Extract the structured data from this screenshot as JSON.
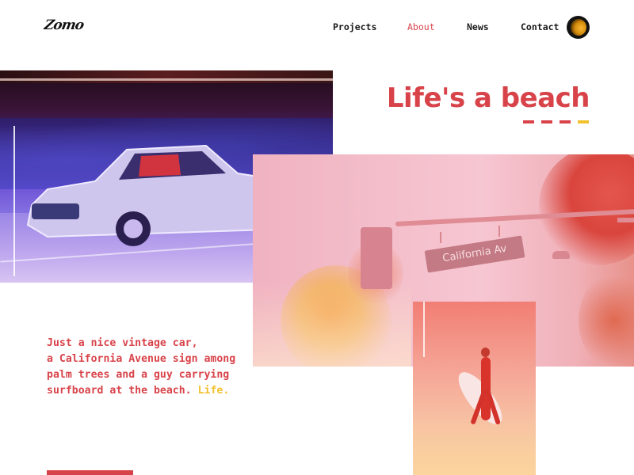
{
  "header": {
    "logo_text": "Zomo",
    "nav": [
      {
        "label": "Projects",
        "active": false
      },
      {
        "label": "About",
        "active": true
      },
      {
        "label": "News",
        "active": false
      },
      {
        "label": "Contact",
        "active": false
      }
    ],
    "avatar_icon": "avatar"
  },
  "hero": {
    "title": "Life's a beach",
    "dash_colors": [
      "#d8434a",
      "#d8434a",
      "#d8434a",
      "#f2c12e"
    ]
  },
  "photos": {
    "car": "vintage-car-photo",
    "street": "california-avenue-sign-photo",
    "street_sign_text": "California Av",
    "surfer": "surfer-on-beach-photo"
  },
  "description": {
    "lines": [
      "Just a nice vintage car,",
      "a California Avenue sign among",
      "palm trees and a guy carrying"
    ],
    "last_line_text": "surfboard at the beach.",
    "highlight": "Life."
  },
  "colors": {
    "accent": "#d8434a",
    "highlight": "#f2c12e",
    "text_dark": "#1a1a1a"
  }
}
